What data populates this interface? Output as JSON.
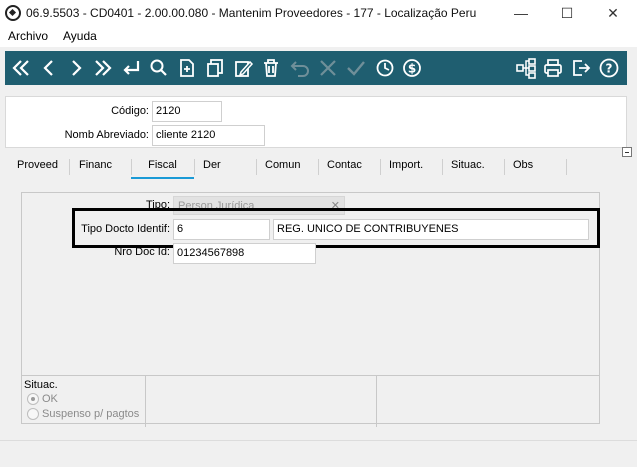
{
  "window": {
    "title": "06.9.5503 - CD0401 - 2.00.00.080 - Mantenim Proveedores - 177 - Localização Peru",
    "minimize_glyph": "—",
    "maximize_glyph": "☐",
    "close_glyph": "✕"
  },
  "menu": {
    "items": [
      "Archivo",
      "Ayuda"
    ]
  },
  "toolbar": {
    "background": "#1f5e70",
    "icons": [
      "first-record-icon",
      "previous-record-icon",
      "next-record-icon",
      "last-record-icon",
      "goto-icon",
      "search-icon",
      "new-document-icon",
      "copy-icon",
      "edit-icon",
      "delete-icon",
      "undo-icon",
      "cancel-icon",
      "confirm-icon",
      "history-icon",
      "currency-icon",
      "hierarchy-icon",
      "print-icon",
      "exit-icon",
      "help-icon"
    ]
  },
  "header": {
    "codigo_label": "Código:",
    "codigo_value": "2120",
    "nomb_label": "Nomb Abreviado:",
    "nomb_value": "cliente 2120"
  },
  "tabs": [
    "Proveed",
    "Financ",
    "Fiscal",
    "Der",
    "Comun",
    "Contac",
    "Import.",
    "Situac.",
    "Obs"
  ],
  "active_tab": "Fiscal",
  "fiscal": {
    "tipo_label": "Tipo:",
    "tipo_value": "Person Jurídica",
    "tipo_docto_label": "Tipo Docto Identif:",
    "tipo_docto_code": "6",
    "tipo_docto_desc": "REG. UNICO DE CONTRIBUYENES",
    "nro_doc_label": "Nro Doc Id:",
    "nro_doc_value": "01234567898"
  },
  "situac": {
    "title": "Situac.",
    "options": [
      {
        "label": "OK",
        "checked": true
      },
      {
        "label": "Suspenso p/ pagtos",
        "checked": false
      }
    ]
  },
  "colors": {
    "accent": "#1a9ad6",
    "highlight_border": "#000000"
  }
}
